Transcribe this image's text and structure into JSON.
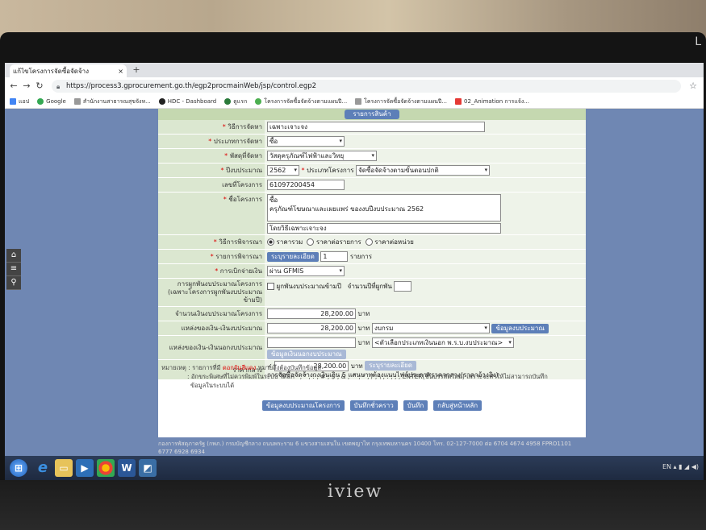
{
  "browser": {
    "tab_title": "แก้ไขโครงการจัดซื้อจัดจ้าง",
    "close_glyph": "×",
    "new_tab_glyph": "+",
    "url": "https://process3.gprocurement.go.th/egp2procmainWeb/jsp/control.egp2",
    "bookmarks": [
      "แอป",
      "Google",
      "สำนักงานสาธารณสุขจังห...",
      "HDC - Dashboard",
      "ดูแรก",
      "โครงการจัดซื้อจัดจ้างตามแผนปี...",
      "โครงการจัดซื้อจัดจ้างตามแผนปี...",
      "02_Animation การแจ้ง..."
    ]
  },
  "form": {
    "header_button": "รายการสินค้า",
    "method_label": "วิธีการจัดหา",
    "method_value": "เฉพาะเจาะจง",
    "type_label": "ประเภทการจัดหา",
    "type_value": "ซื้อ",
    "supply_label": "พัสดุที่จัดหา",
    "supply_value": "วัสดุครุภัณฑ์ไฟฟ้าและวิทยุ",
    "budget_year_label": "ปีงบประมาณ",
    "budget_year_value": "2562",
    "project_type_label": "ประเภทโครงการ",
    "project_type_value": "จัดซื้อจัดจ้างตามขั้นตอนปกติ",
    "project_no_label": "เลขที่โครงการ",
    "project_no_value": "61097200454",
    "project_name_label": "ชื่อโครงการ",
    "project_name_line1": "ซื้อ",
    "project_name_line2": "ครุภัณฑ์โฆษณาและเผยแพร่ ของงบปีงบประมาณ 2562",
    "project_name_line3": "โดยวิธีเฉพาะเจาะจง",
    "consider_label": "วิธีการพิจารณา",
    "consider_opt1": "ราคารวม",
    "consider_opt2": "ราคาต่อรายการ",
    "consider_opt3": "ราคาต่อหน่วย",
    "items_label": "รายการพิจารณา",
    "items_button": "ระบุรายละเอียด",
    "items_count": "1",
    "items_unit": "รายการ",
    "disburse_label": "การเบิกจ่ายเงิน",
    "disburse_value": "ผ่าน GFMIS",
    "commit_label": "การผูกพันงบประมาณโครงการ (เฉพาะโครงการผูกพันงบประมาณข้ามปี)",
    "commit_check": "ผูกพันงบประมาณข้ามปี",
    "commit_years_label": "จำนวนปีที่ผูกพัน",
    "amount_label": "จำนวนเงินงบประมาณโครงการ",
    "amount_value": "28,200.00",
    "baht": "บาท",
    "source_label": "แหล่งของเงิน-เงินงบประมาณ",
    "source_amount": "28,200.00",
    "source_select": "งบกรม",
    "source_button": "ข้อมูลงบประมาณ",
    "offbudget_label": "แหล่งของเงิน-เงินนอกงบประมาณ",
    "offbudget_button": "ข้อมูลเงินนอกงบประมาณ",
    "offbudget_select": "<ตัวเลือกประเภทเงินนอก พ.ร.บ.งบประมาณ>",
    "midprice_label": "ราคากลาง",
    "midprice_value": "28,200.00",
    "midprice_button": "ระบุรายละเอียด",
    "midprice_note": "การจัดซื้อจัดจ้างวงเงินเกิน 5 แสนบาทต้องแนบไฟล์ประกาศราคากลาง(ราคาอ้างอิง)"
  },
  "notes": {
    "prefix": "หมายเหตุ : รายการที่มี",
    "red": "ดอกจันสีแดง",
    "suffix": "หมายถึงต้องบันทึกข้อมูล",
    "line2": ": อักขระพิเศษที่ไม่ควรพิมพ์ในระบบ ได้แก่ ' , \" , ! , # , $ , & , ^ , * , / , \\ , : , ; , ENTER(ขึ้นบรรทัดใหม่) เพราะจะทำให้ไม่สามารถบันทึก",
    "line3": "ข้อมูลในระบบได้"
  },
  "actions": {
    "project_budget": "ข้อมูลงบประมาณโครงการ",
    "save_draft": "บันทึกชั่วคราว",
    "save": "บันทึก",
    "back": "กลับสู่หน้าหลัก"
  },
  "footer": {
    "line1": "กองการพัสดุภาครัฐ (กพภ.) กรมบัญชีกลาง ถนนพระราม 6 แขวงสามเสนใน เขตพญาไท กรุงเทพมหานคร 10400 โทร. 02-127-7000 ต่อ 6704 4674 4958 FPRO1101",
    "line2": "6777 6928 6934"
  },
  "tv": {
    "brand": "iview",
    "corner": "L"
  },
  "taskbar": {
    "tray": "EN"
  }
}
